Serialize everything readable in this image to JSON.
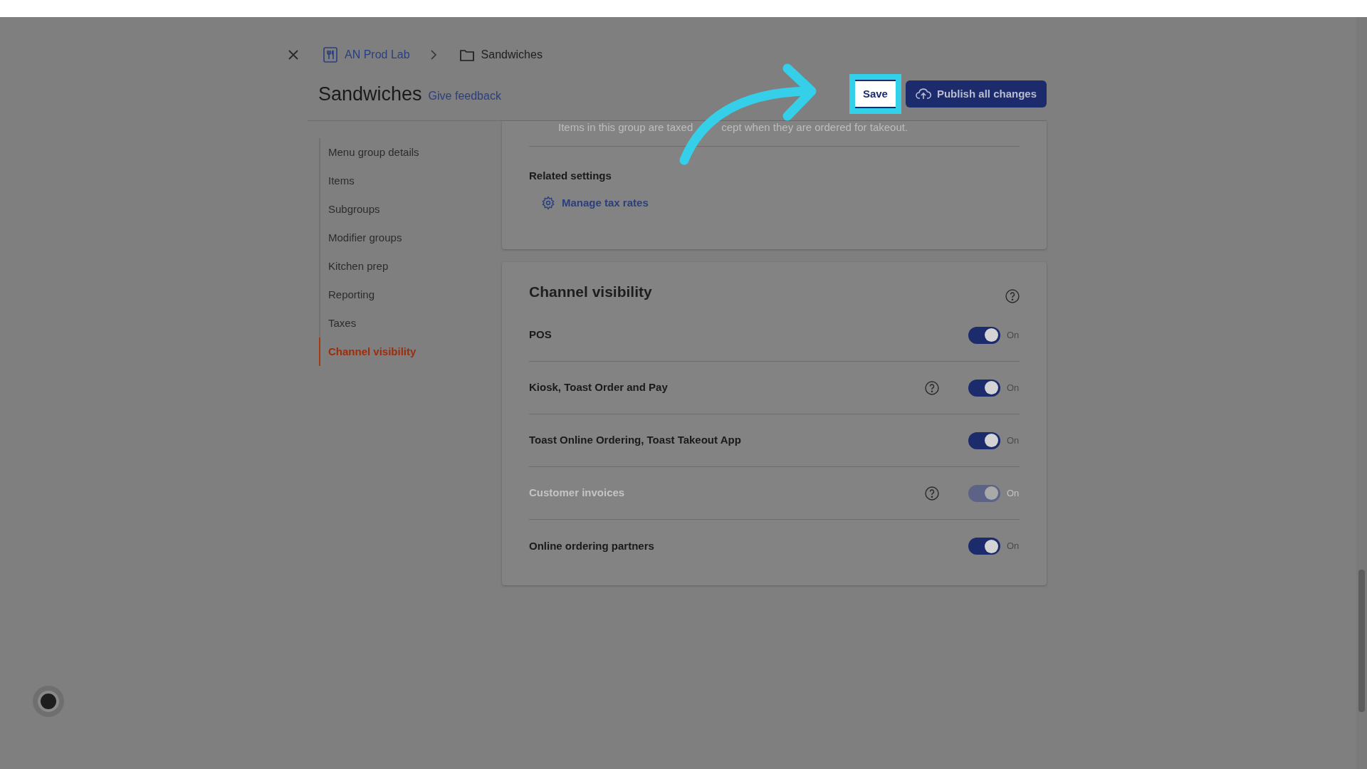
{
  "breadcrumb": [
    {
      "label": "AN Prod Lab",
      "kind": "restaurant"
    },
    {
      "label": "Sandwiches",
      "kind": "folder"
    }
  ],
  "header": {
    "title": "Sandwiches",
    "feedback_link": "Give feedback",
    "buttons": [
      {
        "label": "Save",
        "kind": "secondary",
        "highlighted": true
      },
      {
        "label": "Publish all changes",
        "kind": "primary",
        "highlighted": false
      }
    ]
  },
  "sidebar": {
    "items": [
      {
        "label": "Menu group details",
        "selected": false
      },
      {
        "label": "Items",
        "selected": false
      },
      {
        "label": "Subgroups",
        "selected": false
      },
      {
        "label": "Modifier groups",
        "selected": false
      },
      {
        "label": "Kitchen prep",
        "selected": false
      },
      {
        "label": "Reporting",
        "selected": false
      },
      {
        "label": "Taxes",
        "selected": false
      },
      {
        "label": "Channel visibility",
        "selected": true
      }
    ]
  },
  "tax_card": {
    "note_parts": [
      "Items in this group are taxed",
      "cept when they are ordered for takeout."
    ],
    "related_heading": "Related settings",
    "link": "Manage tax rates"
  },
  "channel_card": {
    "title": "Channel visibility",
    "channels": [
      {
        "name": "POS",
        "help": false,
        "on": true,
        "disabled": false,
        "state_label": "On"
      },
      {
        "name": "Kiosk, Toast Order and Pay",
        "help": true,
        "on": true,
        "disabled": false,
        "state_label": "On"
      },
      {
        "name": "Toast Online Ordering, Toast Takeout App",
        "help": false,
        "on": true,
        "disabled": false,
        "state_label": "On"
      },
      {
        "name": "Customer invoices",
        "help": true,
        "on": true,
        "disabled": true,
        "state_label": "On"
      },
      {
        "name": "Online ordering partners",
        "help": false,
        "on": true,
        "disabled": false,
        "state_label": "On"
      }
    ]
  }
}
